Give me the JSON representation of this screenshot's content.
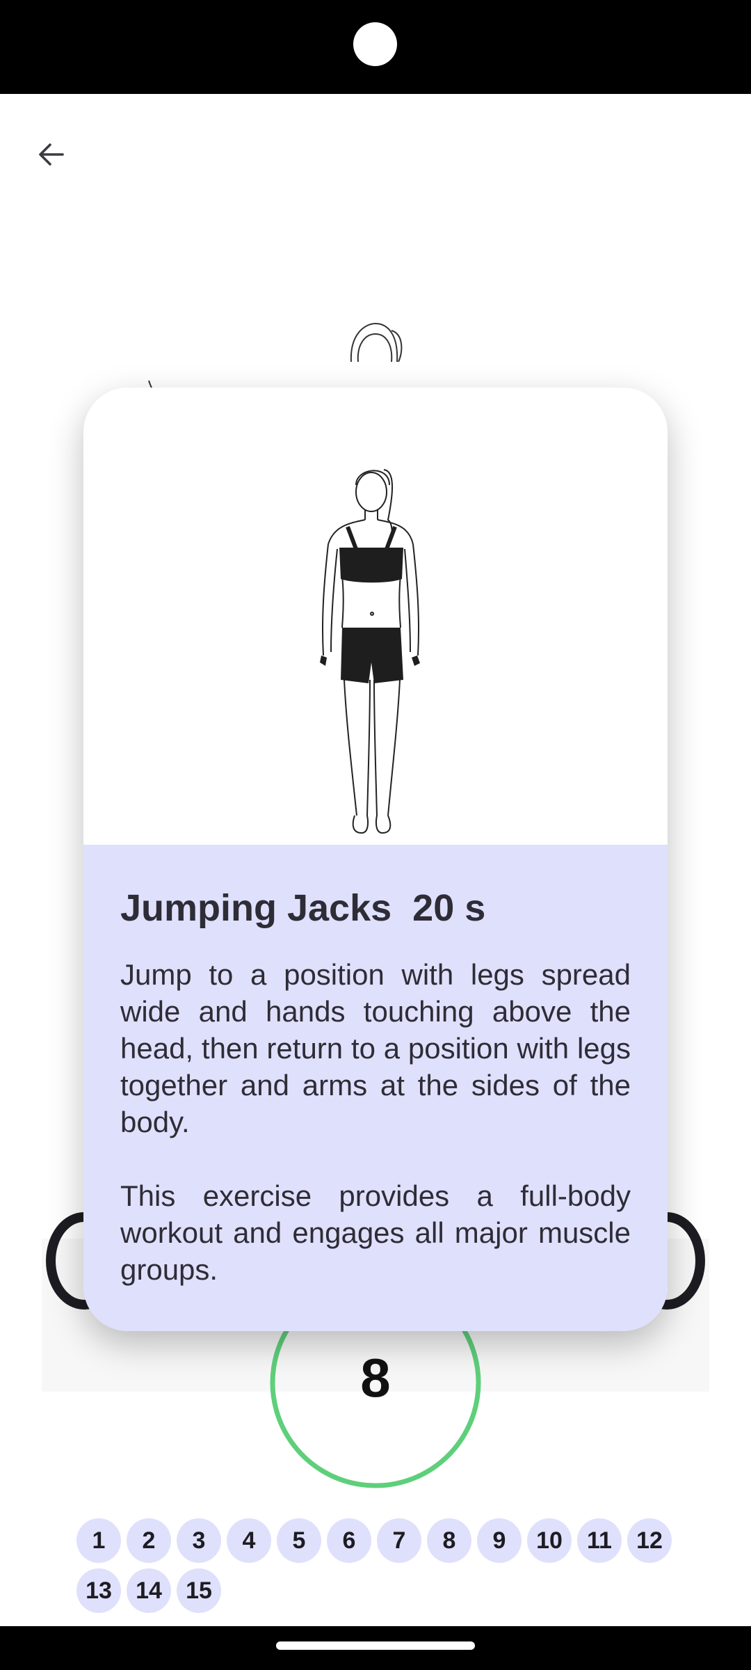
{
  "exercise": {
    "name": "Jumping Jacks",
    "duration": "20 s",
    "description": [
      "Jump to a position with legs spread wide and hands touching above the head, then return to a position with legs together and arms at the sides of the body.",
      "This exercise provides a full-body workout and engages all major muscle groups."
    ]
  },
  "timer": {
    "count": "8",
    "progress_fraction": 0.93,
    "color": "#5ecf7a"
  },
  "steps": [
    "1",
    "2",
    "3",
    "4",
    "5",
    "6",
    "7",
    "8",
    "9",
    "10",
    "11",
    "12",
    "13",
    "14",
    "15"
  ],
  "icons": {
    "back": "arrow-left-icon"
  },
  "colors": {
    "card_body": "#dfe0fc",
    "step_bg": "#dfe0fc"
  }
}
